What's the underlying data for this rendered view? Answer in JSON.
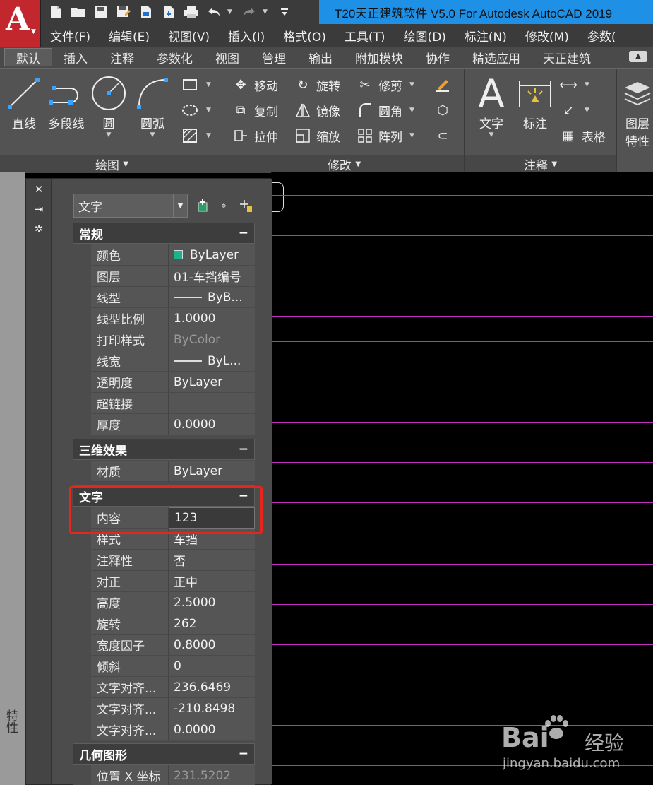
{
  "titlebar": {
    "title": "T20天正建筑软件 V5.0 For Autodesk AutoCAD 2019",
    "logo_letter": "A"
  },
  "menubar": [
    "文件(F)",
    "编辑(E)",
    "视图(V)",
    "插入(I)",
    "格式(O)",
    "工具(T)",
    "绘图(D)",
    "标注(N)",
    "修改(M)",
    "参数("
  ],
  "ribbon_tabs": [
    "默认",
    "插入",
    "注释",
    "参数化",
    "视图",
    "管理",
    "输出",
    "附加模块",
    "协作",
    "精选应用",
    "天正建筑"
  ],
  "ribbon": {
    "draw": {
      "footer": "绘图",
      "tools": [
        "直线",
        "多段线",
        "圆",
        "圆弧"
      ]
    },
    "modify": {
      "footer": "修改",
      "tools": [
        "移动",
        "旋转",
        "修剪",
        "复制",
        "镜像",
        "圆角",
        "拉伸",
        "缩放",
        "阵列"
      ]
    },
    "annotate": {
      "footer": "注释",
      "tools": [
        "文字",
        "标注",
        "表格"
      ]
    },
    "layer": {
      "label1": "图层",
      "label2": "特性"
    }
  },
  "left_strip_label": "特性",
  "palette": {
    "selection": "文字",
    "sections": {
      "general": {
        "title": "常规",
        "rows": [
          {
            "k": "颜色",
            "v": "ByLayer"
          },
          {
            "k": "图层",
            "v": "01-车挡编号"
          },
          {
            "k": "线型",
            "v": "ByB..."
          },
          {
            "k": "线型比例",
            "v": "1.0000"
          },
          {
            "k": "打印样式",
            "v": "ByColor"
          },
          {
            "k": "线宽",
            "v": "ByL..."
          },
          {
            "k": "透明度",
            "v": "ByLayer"
          },
          {
            "k": "超链接",
            "v": ""
          },
          {
            "k": "厚度",
            "v": "0.0000"
          }
        ]
      },
      "effects3d": {
        "title": "三维效果",
        "rows": [
          {
            "k": "材质",
            "v": "ByLayer"
          }
        ]
      },
      "text": {
        "title": "文字",
        "rows": [
          {
            "k": "内容",
            "v": "123"
          },
          {
            "k": "样式",
            "v": "车挡"
          },
          {
            "k": "注释性",
            "v": "否"
          },
          {
            "k": "对正",
            "v": "正中"
          },
          {
            "k": "高度",
            "v": "2.5000"
          },
          {
            "k": "旋转",
            "v": "262"
          },
          {
            "k": "宽度因子",
            "v": "0.8000"
          },
          {
            "k": "倾斜",
            "v": "0"
          },
          {
            "k": "文字对齐...",
            "v": "236.6469"
          },
          {
            "k": "文字对齐...",
            "v": "-210.8498"
          },
          {
            "k": "文字对齐...",
            "v": "0.0000"
          }
        ]
      },
      "geometry": {
        "title": "几何图形",
        "rows": [
          {
            "k": "位置 X 坐标",
            "v": "231.5202"
          }
        ]
      }
    },
    "collapse_symbol": "−"
  },
  "watermark": {
    "brand": "Bai",
    "suffix": "经验",
    "url": "jingyan.baidu.com"
  },
  "colors": {
    "canvas_line": "#c22fc2",
    "highlight": "#e6251c",
    "title_bar": "#1e90e6",
    "swatch": "#18b48c"
  }
}
